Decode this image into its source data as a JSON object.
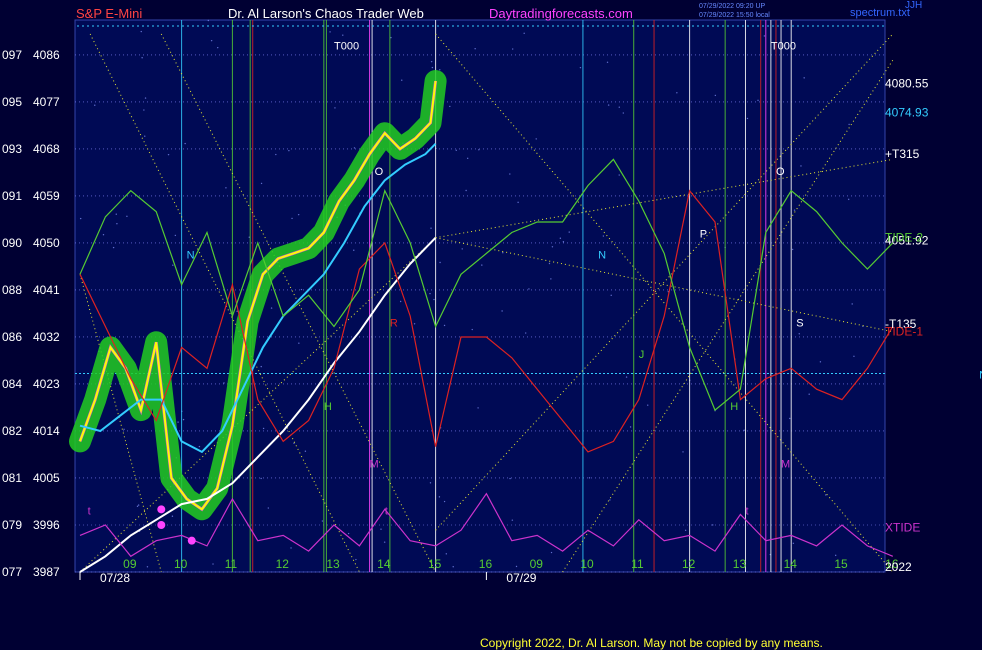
{
  "header": {
    "symbol": "S&P E-Mini",
    "author_title": "Dr. Al Larson's Chaos Trader Web",
    "site": "Daytradingforecasts.com",
    "small_line1": "07/29/2022 09:20 UP",
    "small_line2": "07/29/2022 15:50 local",
    "spectrum": "spectrum.txt",
    "right_tag": "JJH"
  },
  "copyright": "Copyright 2022, Dr. Al Larson. May not be copied by any means.",
  "colors": {
    "background": "#000033",
    "grid": "#8888ff",
    "price": "#ffff00",
    "price_glow": "#22cc22",
    "ma_fast": "#33ccff",
    "ma_slow": "#ffffff",
    "tide1": "#dd2222",
    "tide2": "#55cc33",
    "xtide": "#cc33cc",
    "gann": "#e6e633",
    "title_red": "#ff4444",
    "title_white": "#ffffff",
    "title_magenta": "#ff44ff"
  },
  "chart_data": {
    "type": "line",
    "title": "S&P E-Mini",
    "xlabel": "",
    "ylabel": "",
    "ylim": [
      3987,
      4090
    ],
    "grid": true,
    "y_ticks": [
      {
        "left": "077",
        "right": "3987",
        "value": 3987
      },
      {
        "left": "079",
        "right": "3996",
        "value": 3996
      },
      {
        "left": "081",
        "right": "4005",
        "value": 4005
      },
      {
        "left": "082",
        "right": "4014",
        "value": 4014
      },
      {
        "left": "084",
        "right": "4023",
        "value": 4023
      },
      {
        "left": "086",
        "right": "4032",
        "value": 4032
      },
      {
        "left": "088",
        "right": "4041",
        "value": 4041
      },
      {
        "left": "090",
        "right": "4050",
        "value": 4050
      },
      {
        "left": "091",
        "right": "4059",
        "value": 4059
      },
      {
        "left": "093",
        "right": "4068",
        "value": 4068
      },
      {
        "left": "095",
        "right": "4077",
        "value": 4077
      },
      {
        "left": "097",
        "right": "4086",
        "value": 4086
      }
    ],
    "x_ticks": [
      "09",
      "10",
      "11",
      "12",
      "13",
      "14",
      "15",
      "16",
      "09",
      "10",
      "11",
      "12",
      "13",
      "14",
      "15",
      "16"
    ],
    "dates": [
      "07/28",
      "07/29"
    ],
    "series": [
      {
        "name": "",
        "role": "price",
        "x": [
          0,
          0.3,
          0.6,
          0.9,
          1.2,
          1.5,
          1.8,
          2.1,
          2.4,
          2.7,
          3.0,
          3.3,
          3.6,
          3.9,
          4.2,
          4.5,
          4.8,
          5.1,
          5.4,
          5.7,
          6.0,
          6.3,
          6.6,
          6.9,
          7.0
        ],
        "y": [
          4012,
          4020,
          4030,
          4026,
          4018,
          4031,
          4005,
          4001,
          3999,
          4003,
          4015,
          4035,
          4044,
          4047,
          4048,
          4049,
          4052,
          4058,
          4062,
          4067,
          4071,
          4068,
          4070,
          4073,
          4081
        ]
      },
      {
        "name": "",
        "role": "ma_fast",
        "x": [
          0,
          0.4,
          0.8,
          1.2,
          1.6,
          2.0,
          2.4,
          2.8,
          3.2,
          3.6,
          4.0,
          4.4,
          4.8,
          5.2,
          5.6,
          6.0,
          6.4,
          6.8,
          7.0
        ],
        "y": [
          4015,
          4014,
          4017,
          4020,
          4020,
          4012,
          4010,
          4014,
          4022,
          4030,
          4036,
          4040,
          4044,
          4050,
          4057,
          4062,
          4065,
          4067,
          4069
        ]
      },
      {
        "name": "",
        "role": "ma_slow",
        "x": [
          0,
          0.5,
          1.0,
          1.5,
          2.0,
          2.5,
          3.0,
          3.5,
          4.0,
          4.5,
          5.0,
          5.5,
          6.0,
          6.5,
          7.0
        ],
        "y": [
          3987,
          3990,
          3994,
          3997,
          4000,
          4001,
          4004,
          4009,
          4014,
          4020,
          4027,
          4033,
          4040,
          4046,
          4051
        ]
      },
      {
        "name": "TIDE-1",
        "role": "tide1",
        "x": [
          0,
          0.5,
          1.0,
          1.5,
          2.0,
          2.5,
          3.0,
          3.5,
          4.0,
          4.5,
          5.0,
          5.5,
          6.0,
          6.5,
          7.0,
          7.5,
          8.0,
          8.5,
          9.0,
          9.5,
          10.0,
          10.5,
          11.0,
          11.5,
          12.0,
          12.5,
          13.0,
          13.5,
          14.0,
          14.5,
          15.0,
          15.5,
          16.0
        ],
        "y": [
          4044,
          4034,
          4024,
          4016,
          4030,
          4026,
          4042,
          4020,
          4012,
          4016,
          4026,
          4045,
          4050,
          4036,
          4011,
          4032,
          4032,
          4028,
          4022,
          4016,
          4010,
          4012,
          4020,
          4036,
          4060,
          4054,
          4020,
          4024,
          4026,
          4022,
          4020,
          4026,
          4034
        ]
      },
      {
        "name": "TIDE-2",
        "role": "tide2",
        "x": [
          0,
          0.5,
          1.0,
          1.5,
          2.0,
          2.5,
          3.0,
          3.5,
          4.0,
          4.5,
          5.0,
          5.5,
          6.0,
          6.5,
          7.0,
          7.5,
          8.0,
          8.5,
          9.0,
          9.5,
          10.0,
          10.5,
          11.0,
          11.5,
          12.0,
          12.5,
          13.0,
          13.5,
          14.0,
          14.5,
          15.0,
          15.5,
          16.0
        ],
        "y": [
          4044,
          4055,
          4060,
          4056,
          4042,
          4052,
          4036,
          4050,
          4036,
          4040,
          4034,
          4041,
          4060,
          4050,
          4034,
          4044,
          4048,
          4052,
          4054,
          4054,
          4061,
          4066,
          4058,
          4048,
          4030,
          4018,
          4022,
          4052,
          4060,
          4056,
          4050,
          4045,
          4050
        ]
      },
      {
        "name": "XTIDE",
        "role": "xtide",
        "x": [
          0,
          0.5,
          1.0,
          1.5,
          2.0,
          2.5,
          3.0,
          3.5,
          4.0,
          4.5,
          5.0,
          5.5,
          6.0,
          6.5,
          7.0,
          7.5,
          8.0,
          8.5,
          9.0,
          9.5,
          10.0,
          10.5,
          11.0,
          11.5,
          12.0,
          12.5,
          13.0,
          13.5,
          14.0,
          14.5,
          15.0,
          15.5,
          16.0
        ],
        "y": [
          3994,
          3996,
          3990,
          3993,
          3994,
          3992,
          4001,
          3993,
          3994,
          3991,
          3996,
          3992,
          3999,
          3993,
          3992,
          3995,
          4002,
          3993,
          3994,
          3991,
          3995,
          3992,
          3997,
          3993,
          3994,
          3991,
          3998,
          3993,
          3994,
          3992,
          3996,
          3992,
          3990
        ]
      }
    ],
    "line_labels": [
      {
        "text": "4080.55",
        "value": 4080.55,
        "color": "#ffffff"
      },
      {
        "text": "4074.93",
        "value": 4074.93,
        "color": "#33ccff"
      },
      {
        "text": "+T315",
        "value": 4067,
        "color": "#ffffff"
      },
      {
        "text": "4051.92",
        "value": 4050.5,
        "color": "#ffffff"
      },
      {
        "text": "-T135",
        "value": 4034.5,
        "color": "#ffffff"
      },
      {
        "text": "TIDE-2",
        "value": 4051,
        "color": "#55cc33"
      },
      {
        "text": "TIDE-1",
        "value": 4033,
        "color": "#dd2222"
      },
      {
        "text": "XTIDE",
        "value": 3995.5,
        "color": "#cc33cc"
      },
      {
        "text": "2022",
        "value": 3988,
        "color": "#ffffff"
      }
    ],
    "markers": [
      {
        "text": "T000",
        "x": 5.0,
        "value": 4087,
        "color": "#ffffff"
      },
      {
        "text": "T000",
        "x": 13.6,
        "value": 4087,
        "color": "#ffffff"
      },
      {
        "text": "N",
        "x": 2.1,
        "value": 4047,
        "color": "#33ccff"
      },
      {
        "text": "N",
        "x": 10.2,
        "value": 4047,
        "color": "#33ccff"
      },
      {
        "text": "O",
        "x": 5.8,
        "value": 4063,
        "color": "#ffffff"
      },
      {
        "text": "O",
        "x": 13.7,
        "value": 4063,
        "color": "#ffffff"
      },
      {
        "text": "R",
        "x": 6.1,
        "value": 4034,
        "color": "#dd2222"
      },
      {
        "text": "P",
        "x": 12.2,
        "value": 4051,
        "color": "#ffffff"
      },
      {
        "text": "S",
        "x": 14.1,
        "value": 4034,
        "color": "#ffffff"
      },
      {
        "text": "H",
        "x": 4.8,
        "value": 4018,
        "color": "#55cc33"
      },
      {
        "text": "H",
        "x": 12.8,
        "value": 4018,
        "color": "#55cc33"
      },
      {
        "text": "J",
        "x": 11.0,
        "value": 4028,
        "color": "#55cc33"
      },
      {
        "text": "M",
        "x": 5.7,
        "value": 4007,
        "color": "#cc33cc"
      },
      {
        "text": "M",
        "x": 13.8,
        "value": 4007,
        "color": "#cc33cc"
      },
      {
        "text": "t",
        "x": 6.0,
        "value": 3998,
        "color": "#cc33cc"
      },
      {
        "text": "t",
        "x": 13.1,
        "value": 3998,
        "color": "#cc33cc"
      },
      {
        "text": "t",
        "x": 0.15,
        "value": 3998,
        "color": "#cc33cc"
      },
      {
        "text": "N",
        "x": 17.7,
        "value": 4024,
        "color": "#33ccff"
      }
    ]
  }
}
